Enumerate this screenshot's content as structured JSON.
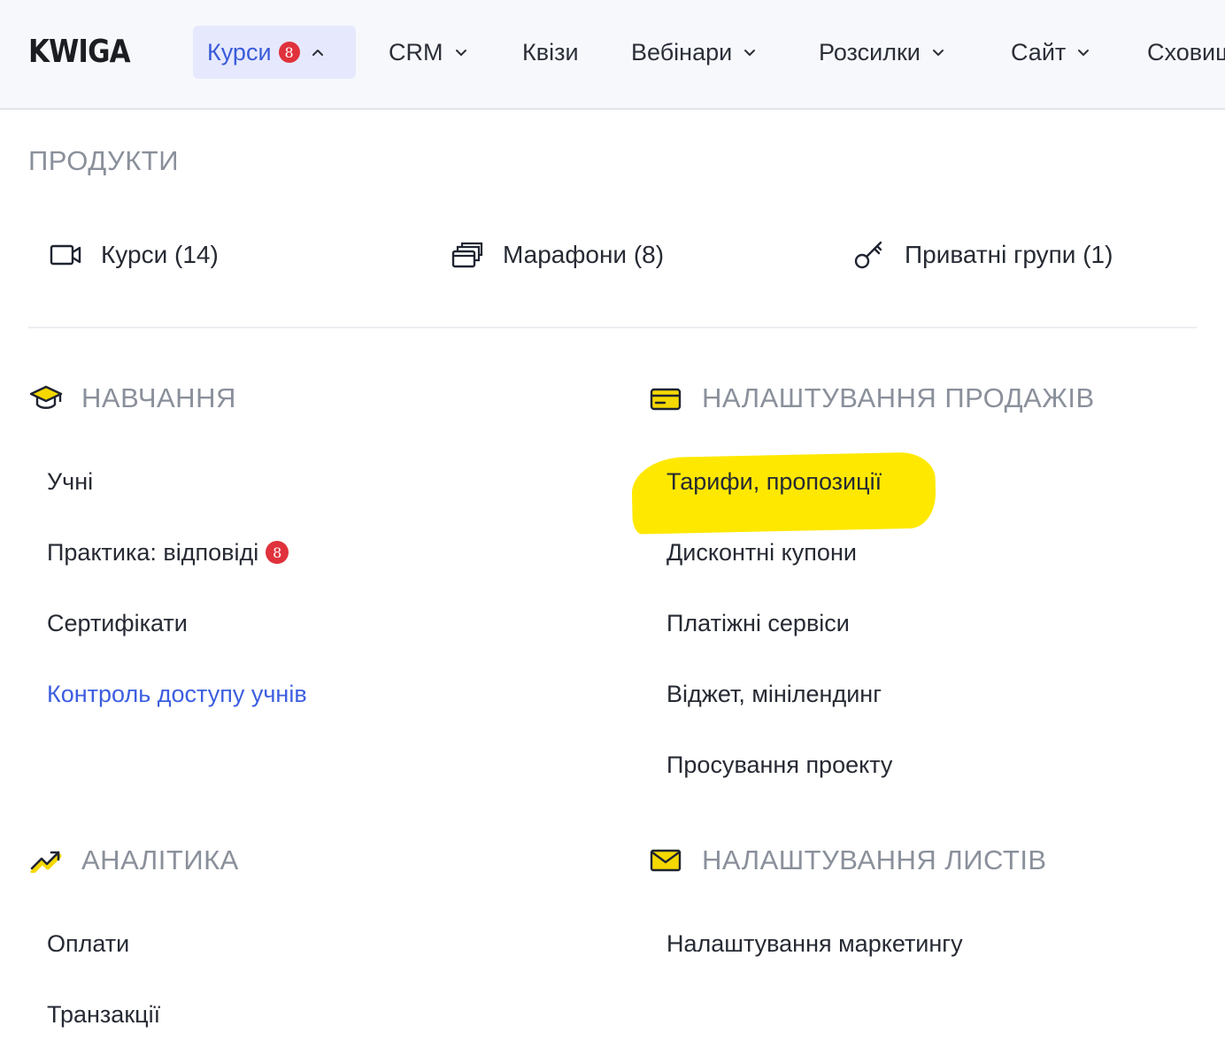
{
  "header": {
    "logo": "KWIGA",
    "nav": [
      {
        "label": "Курси",
        "badge": "8",
        "chevron": "chevron-up"
      },
      {
        "label": "CRM",
        "chevron": "chevron-down"
      },
      {
        "label": "Квізи"
      },
      {
        "label": "Вебінари",
        "chevron": "chevron-down"
      },
      {
        "label": "Розсилки",
        "chevron": "chevron-down"
      },
      {
        "label": "Сайт",
        "chevron": "chevron-down"
      },
      {
        "label": "Сховищ"
      }
    ]
  },
  "products": {
    "title": "ПРОДУКТИ",
    "items": [
      {
        "label": "Курси (14)",
        "icon": "video-camera-icon"
      },
      {
        "label": "Марафони (8)",
        "icon": "stacked-windows-icon"
      },
      {
        "label": "Приватні групи (1)",
        "icon": "key-icon"
      }
    ]
  },
  "learning": {
    "title": "НАВЧАННЯ",
    "icon": "graduation-cap-icon",
    "items": [
      {
        "label": "Учні"
      },
      {
        "label": "Практика: відповіді",
        "badge": "8"
      },
      {
        "label": "Сертифікати"
      },
      {
        "label": "Контроль доступу учнів",
        "color": "#3c5ee0"
      }
    ]
  },
  "sales": {
    "title": "НАЛАШТУВАННЯ ПРОДАЖІВ",
    "icon": "credit-card-icon",
    "items": [
      {
        "label": "Тарифи, пропозиції",
        "highlight": "#ffe800"
      },
      {
        "label": "Дисконтні купони"
      },
      {
        "label": "Платіжні сервіси"
      },
      {
        "label": "Віджет, мінілендинг"
      },
      {
        "label": "Просування проекту"
      }
    ]
  },
  "analytics": {
    "title": "АНАЛІТИКА",
    "icon": "trending-up-icon",
    "items": [
      {
        "label": "Оплати"
      },
      {
        "label": "Транзакції"
      }
    ]
  },
  "emails": {
    "title": "НАЛАШТУВАННЯ ЛИСТІВ",
    "icon": "envelope-icon",
    "items": [
      {
        "label": "Налаштування маркетингу"
      }
    ]
  },
  "colors": {
    "accent": "#3c5ee0",
    "badge": "#e0323c",
    "icon_yellow": "#f5d800"
  }
}
